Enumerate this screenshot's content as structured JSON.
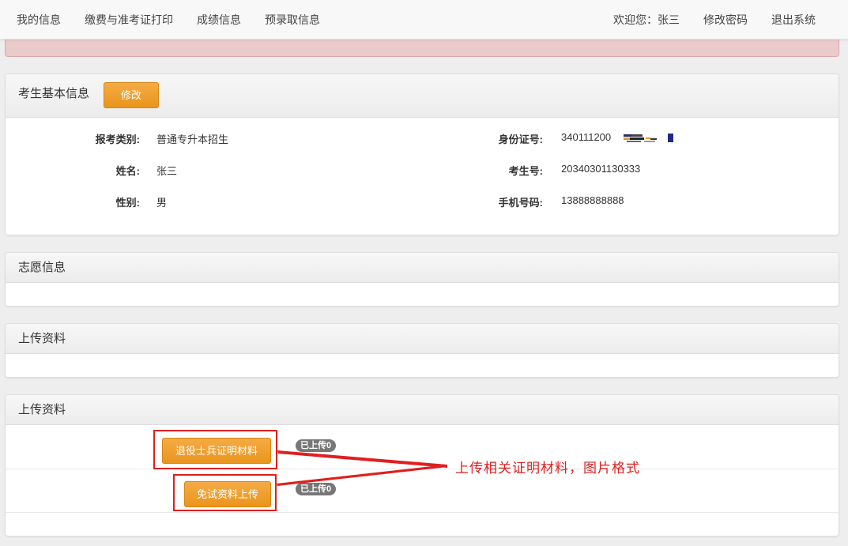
{
  "nav": {
    "my_info": "我的信息",
    "fee_print": "缴费与准考证打印",
    "score_info": "成绩信息",
    "pre_admission": "预录取信息",
    "welcome": "欢迎您：张三",
    "change_password": "修改密码",
    "logout": "退出系统"
  },
  "basic_info": {
    "title": "考生基本信息",
    "edit_button": "修改",
    "fields": {
      "exam_type_label": "报考类别:",
      "exam_type_value": "普通专升本招生",
      "name_label": "姓名:",
      "name_value": "张三",
      "gender_label": "性别:",
      "gender_value": "男",
      "id_label": "身份证号:",
      "id_value": "340111200",
      "exam_no_label": "考生号:",
      "exam_no_value": "20340301130333",
      "phone_label": "手机号码:",
      "phone_value": "13888888888"
    }
  },
  "volunteer": {
    "title": "志愿信息"
  },
  "upload1": {
    "title": "上传资料"
  },
  "upload2": {
    "title": "上传资料",
    "veteran_button": "退役士兵证明材料",
    "veteran_badge": "已上传0",
    "exempt_button": "免试资料上传",
    "exempt_badge": "已上传0"
  },
  "annotation": {
    "text": "上传相关证明材料，图片格式"
  },
  "colors": {
    "accent_orange": "#ea951c",
    "annotation_red": "#e01e1e",
    "alert_bg": "#ebcacc",
    "badge_gray": "#777777"
  }
}
